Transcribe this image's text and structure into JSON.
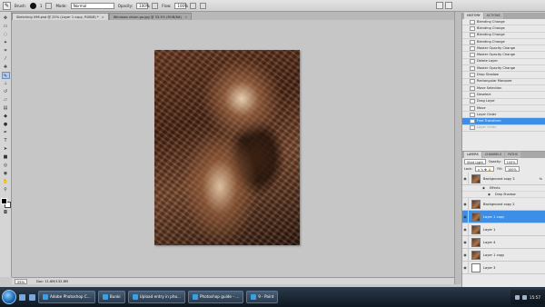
{
  "options_bar": {
    "brush_label": "Brush:",
    "brush_size": "1",
    "mode_label": "Mode:",
    "mode_value": "Normal",
    "opacity_label": "Opacity:",
    "opacity_value": "100%",
    "flow_label": "Flow:",
    "flow_value": "100%"
  },
  "doc_tabs": [
    {
      "label": "Sketching 096.psd @ 25% (Layer 1 copy, RGB/8) *",
      "active": true
    },
    {
      "label": "Windows vision.ga.jpg @ 33.3% (RGB/8#)",
      "active": false
    }
  ],
  "status_bar": {
    "zoom": "25%",
    "doc_size": "Doc: 11.6M/132.8M"
  },
  "history": {
    "tabs": [
      "HISTORY",
      "ACTIONS"
    ],
    "items": [
      {
        "label": "Blending Change",
        "state": "normal"
      },
      {
        "label": "Blending Change",
        "state": "normal"
      },
      {
        "label": "Blending Change",
        "state": "normal"
      },
      {
        "label": "Blending Change",
        "state": "normal"
      },
      {
        "label": "Master Opacity Change",
        "state": "normal"
      },
      {
        "label": "Master Opacity Change",
        "state": "normal"
      },
      {
        "label": "Delete Layer",
        "state": "normal"
      },
      {
        "label": "Master Opacity Change",
        "state": "normal"
      },
      {
        "label": "Drop Shadow",
        "state": "normal"
      },
      {
        "label": "Rectangular Marquee",
        "state": "normal"
      },
      {
        "label": "Move Selection",
        "state": "normal"
      },
      {
        "label": "Deselect",
        "state": "normal"
      },
      {
        "label": "Drag Layer",
        "state": "normal"
      },
      {
        "label": "Move",
        "state": "normal"
      },
      {
        "label": "Layer Order",
        "state": "normal"
      },
      {
        "label": "Free Transform",
        "state": "selected"
      },
      {
        "label": "Layer Order",
        "state": "dim"
      }
    ]
  },
  "layers": {
    "tabs": [
      "LAYERS",
      "CHANNELS",
      "PATHS"
    ],
    "blend_mode": "Vivid Light",
    "opacity_label": "Opacity:",
    "opacity_value": "100%",
    "lock_label": "Lock:",
    "fill_label": "Fill:",
    "fill_value": "100%",
    "effects_label": "Effects",
    "drop_shadow_label": "Drop Shadow",
    "fx_label": "fx",
    "rows": [
      {
        "name": "Background copy 3",
        "selected": false,
        "thumb": "image",
        "fx": true
      },
      {
        "name": "Background copy 2",
        "selected": false,
        "thumb": "image",
        "fx": false
      },
      {
        "name": "Layer 1 copy",
        "selected": true,
        "thumb": "image",
        "fx": false
      },
      {
        "name": "Layer 1",
        "selected": false,
        "thumb": "image",
        "fx": false
      },
      {
        "name": "Layer 4",
        "selected": false,
        "thumb": "image",
        "fx": false
      },
      {
        "name": "Layer 1 copy",
        "selected": false,
        "thumb": "image",
        "fx": false
      },
      {
        "name": "Layer 3",
        "selected": false,
        "thumb": "white",
        "fx": false
      }
    ]
  },
  "taskbar": {
    "tasks": [
      "Adobe Photoshop C...",
      "Bunki",
      "Upload entry in pho...",
      "Photoshop guide - ...",
      "9 - Paint"
    ],
    "clock": "15:57"
  },
  "colors": {
    "selection_blue": "#3d8ee6",
    "canvas_bg": "#c6c6c6"
  }
}
